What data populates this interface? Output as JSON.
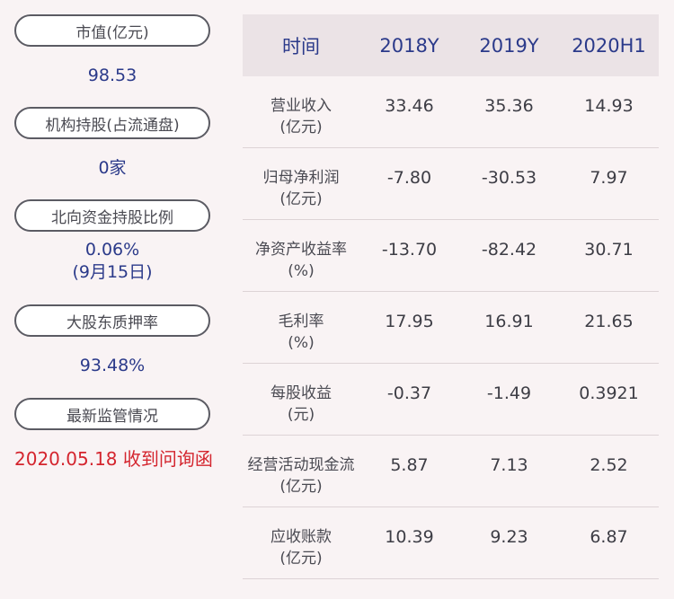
{
  "left": {
    "items": [
      {
        "label": "市值(亿元)",
        "value": "98.53",
        "value2": ""
      },
      {
        "label": "机构持股(占流通盘)",
        "value": "0家",
        "value2": ""
      },
      {
        "label": "北向资金持股比例",
        "value": "0.06%",
        "value2": "(9月15日)"
      },
      {
        "label": "大股东质押率",
        "value": "93.48%",
        "value2": ""
      },
      {
        "label": "最新监管情况",
        "value": "2020.05.18 收到问询函",
        "value2": ""
      }
    ]
  },
  "table": {
    "headers": [
      "时间",
      "2018Y",
      "2019Y",
      "2020H1"
    ],
    "rows": [
      {
        "label1": "营业收入",
        "label2": "(亿元)",
        "values": [
          "33.46",
          "35.36",
          "14.93"
        ]
      },
      {
        "label1": "归母净利润",
        "label2": "(亿元)",
        "values": [
          "-7.80",
          "-30.53",
          "7.97"
        ]
      },
      {
        "label1": "净资产收益率",
        "label2": "(%)",
        "values": [
          "-13.70",
          "-82.42",
          "30.71"
        ]
      },
      {
        "label1": "毛利率",
        "label2": "(%)",
        "values": [
          "17.95",
          "16.91",
          "21.65"
        ]
      },
      {
        "label1": "每股收益",
        "label2": "(元)",
        "values": [
          "-0.37",
          "-1.49",
          "0.3921"
        ]
      },
      {
        "label1": "经营活动现金流",
        "label2": "(亿元)",
        "values": [
          "5.87",
          "7.13",
          "2.52"
        ]
      },
      {
        "label1": "应收账款",
        "label2": "(亿元)",
        "values": [
          "10.39",
          "9.23",
          "6.87"
        ]
      }
    ]
  },
  "colors": {
    "background": "#f9f3f4",
    "header_bg": "#ebe3e6",
    "accent_blue": "#2b3a8a",
    "alert_red": "#d4252e",
    "pill_border": "#5b5b63"
  }
}
